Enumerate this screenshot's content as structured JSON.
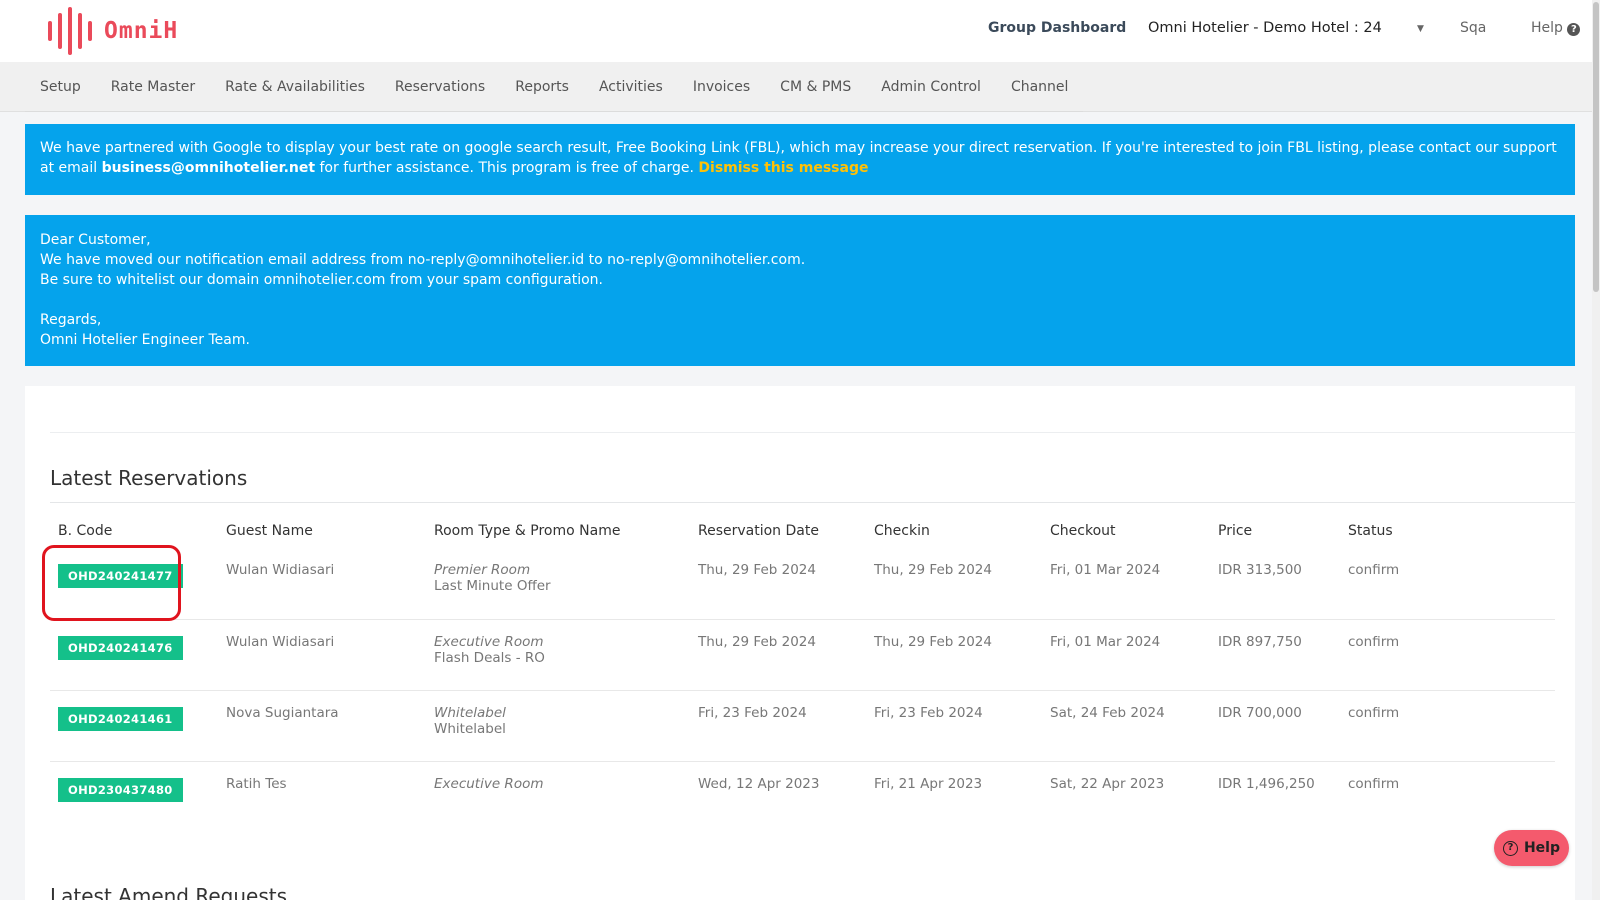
{
  "header": {
    "logo_text": "OmniH",
    "group_dashboard": "Group Dashboard",
    "hotel_select": "Omni Hotelier - Demo Hotel : 24",
    "user": "Sqa",
    "help": "Help",
    "help_icon": "question-circle-icon"
  },
  "nav": {
    "items": [
      "Setup",
      "Rate Master",
      "Rate & Availabilities",
      "Reservations",
      "Reports",
      "Activities",
      "Invoices",
      "CM & PMS",
      "Admin Control",
      "Channel"
    ]
  },
  "notice_google": {
    "text_1": "We have partnered with Google to display your best rate on google search result, Free Booking Link (FBL), which may increase your direct reservation. If you're interested to join FBL listing, please contact our support at email ",
    "email": "business@omnihotelier.net",
    "text_2": " for further assistance. This program is free of charge. ",
    "dismiss": "Dismiss this message"
  },
  "notice_email": {
    "line_1": "Dear Customer,",
    "line_2": "We have moved our notification email address from no-reply@omnihotelier.id to no-reply@omnihotelier.com.",
    "line_3": "Be sure to whitelist our domain omnihotelier.com from your spam configuration.",
    "line_4": "Regards,",
    "line_5": "Omni Hotelier Engineer Team."
  },
  "latest_reservations": {
    "title": "Latest Reservations",
    "columns": [
      "B. Code",
      "Guest Name",
      "Room Type & Promo Name",
      "Reservation Date",
      "Checkin",
      "Checkout",
      "Price",
      "Status"
    ],
    "rows": [
      {
        "code": "OHD240241477",
        "guest": "Wulan Widiasari",
        "room": "Premier Room",
        "promo": "Last Minute Offer",
        "res_date": "Thu, 29 Feb 2024",
        "checkin": "Thu, 29 Feb 2024",
        "checkout": "Fri, 01 Mar 2024",
        "price": "IDR 313,500",
        "status": "confirm"
      },
      {
        "code": "OHD240241476",
        "guest": "Wulan Widiasari",
        "room": "Executive Room",
        "promo": "Flash Deals - RO",
        "res_date": "Thu, 29 Feb 2024",
        "checkin": "Thu, 29 Feb 2024",
        "checkout": "Fri, 01 Mar 2024",
        "price": "IDR 897,750",
        "status": "confirm"
      },
      {
        "code": "OHD240241461",
        "guest": "Nova Sugiantara",
        "room": "Whitelabel",
        "promo": "Whitelabel",
        "res_date": "Fri, 23 Feb 2024",
        "checkin": "Fri, 23 Feb 2024",
        "checkout": "Sat, 24 Feb 2024",
        "price": "IDR 700,000",
        "status": "confirm"
      },
      {
        "code": "OHD230437480",
        "guest": "Ratih Tes",
        "room": "Executive Room",
        "promo": "",
        "res_date": "Wed, 12 Apr 2023",
        "checkin": "Fri, 21 Apr 2023",
        "checkout": "Sat, 22 Apr 2023",
        "price": "IDR 1,496,250",
        "status": "confirm"
      }
    ]
  },
  "latest_amend": {
    "title": "Latest Amend Requests"
  },
  "help_float": {
    "label": "Help"
  },
  "colors": {
    "brand": "#ea4a5a",
    "notice_bg": "#05a3ec",
    "code_badge": "#14c08a",
    "dismiss": "#ffc107",
    "highlight": "#e0141e"
  }
}
